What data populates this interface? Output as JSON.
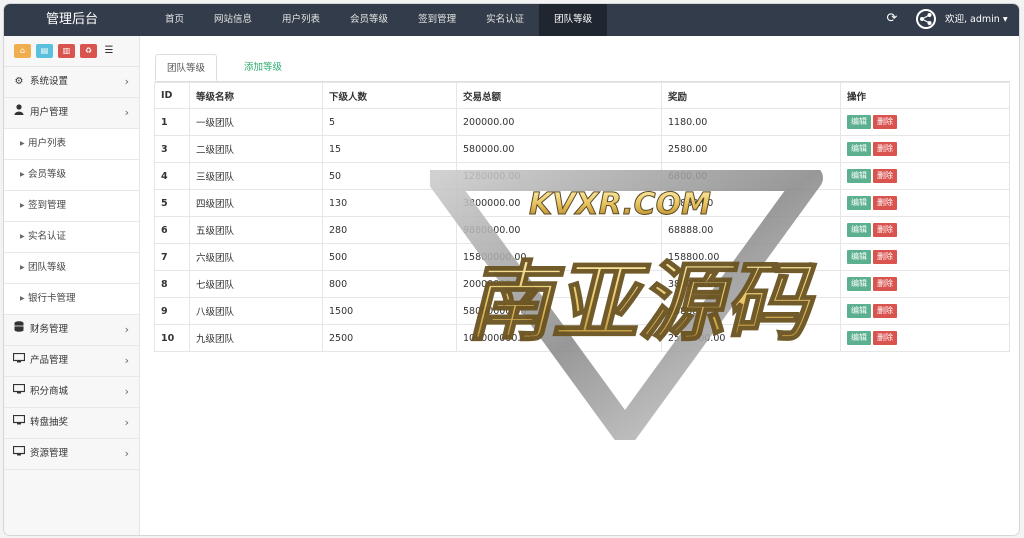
{
  "app": {
    "brand": "管理后台"
  },
  "nav": {
    "items": [
      "首页",
      "网站信息",
      "用户列表",
      "会员等级",
      "签到管理",
      "实名认证",
      "团队等级"
    ],
    "active": "团队等级"
  },
  "user": {
    "greeting": "欢迎, admin ▾"
  },
  "sidebar": {
    "shortcut_icons": [
      "home-icon",
      "file-icon",
      "trash-icon",
      "recycle-icon",
      "list-icon"
    ],
    "menu": [
      {
        "label": "系统设置",
        "icon": "gears-icon"
      },
      {
        "label": "用户管理",
        "icon": "user-icon"
      },
      {
        "label": "财务管理",
        "icon": "database-icon"
      },
      {
        "label": "产品管理",
        "icon": "monitor-icon"
      },
      {
        "label": "积分商城",
        "icon": "monitor-icon"
      },
      {
        "label": "转盘抽奖",
        "icon": "monitor-icon"
      },
      {
        "label": "资源管理",
        "icon": "monitor-icon"
      }
    ],
    "submenu": [
      "用户列表",
      "会员等级",
      "签到管理",
      "实名认证",
      "团队等级",
      "银行卡管理"
    ]
  },
  "tabs": {
    "active": "团队等级",
    "add": "添加等级"
  },
  "table": {
    "headers": [
      "ID",
      "等级名称",
      "下级人数",
      "交易总额",
      "奖励",
      "操作"
    ],
    "rows": [
      [
        "1",
        "一级团队",
        "5",
        "200000.00",
        "1180.00"
      ],
      [
        "3",
        "二级团队",
        "15",
        "580000.00",
        "2580.00"
      ],
      [
        "4",
        "三级团队",
        "50",
        "1280000.00",
        "6800.00"
      ],
      [
        "5",
        "四级团队",
        "130",
        "3800000.00",
        "18888.00"
      ],
      [
        "6",
        "五级团队",
        "280",
        "9880000.00",
        "68888.00"
      ],
      [
        "7",
        "六级团队",
        "500",
        "15800000.00",
        "158800.00"
      ],
      [
        "8",
        "七级团队",
        "800",
        "20000000.00",
        "380000.00"
      ],
      [
        "9",
        "八级团队",
        "1500",
        "58000000.00",
        "888880.00"
      ],
      [
        "10",
        "九级团队",
        "2500",
        "100000000.00",
        "2580000.00"
      ]
    ],
    "edit_label": "编辑",
    "delete_label": "删除"
  },
  "watermark": {
    "top_text": "KVXR.COM",
    "main_text": "南亚源码"
  },
  "colors": {
    "topbar": "#333c4a",
    "edit": "#5cb08f",
    "delete": "#d9534f",
    "link": "#2eab6f"
  }
}
